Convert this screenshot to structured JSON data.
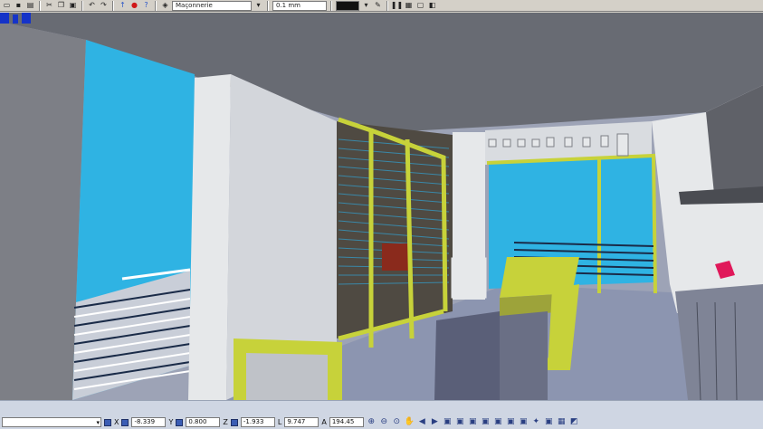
{
  "toolbar": {
    "layer_name": "Maçonnerie",
    "line_weight": "0.1 mm",
    "icons": [
      "open-icon",
      "save-icon",
      "print-icon",
      "cut-icon",
      "copy-icon",
      "paste-icon",
      "undo-icon",
      "redo-icon",
      "pointer-icon",
      "stop-icon",
      "help-icon",
      "layer-icon"
    ]
  },
  "statusbar": {
    "x_label": "X",
    "x_value": "-8.339",
    "y_label": "Y",
    "y_value": "0.800",
    "z_label": "Z",
    "z_value": "-1.933",
    "l_label": "L",
    "l_value": "9.747",
    "a_label": "A",
    "a_value": "194.45"
  },
  "colors": {
    "sky": "#2fb3e3",
    "floor": "#8c95b0",
    "frame_yellow": "#c7d23a",
    "wall_white": "#e6e8ea",
    "ceiling": "#6c6f77"
  }
}
